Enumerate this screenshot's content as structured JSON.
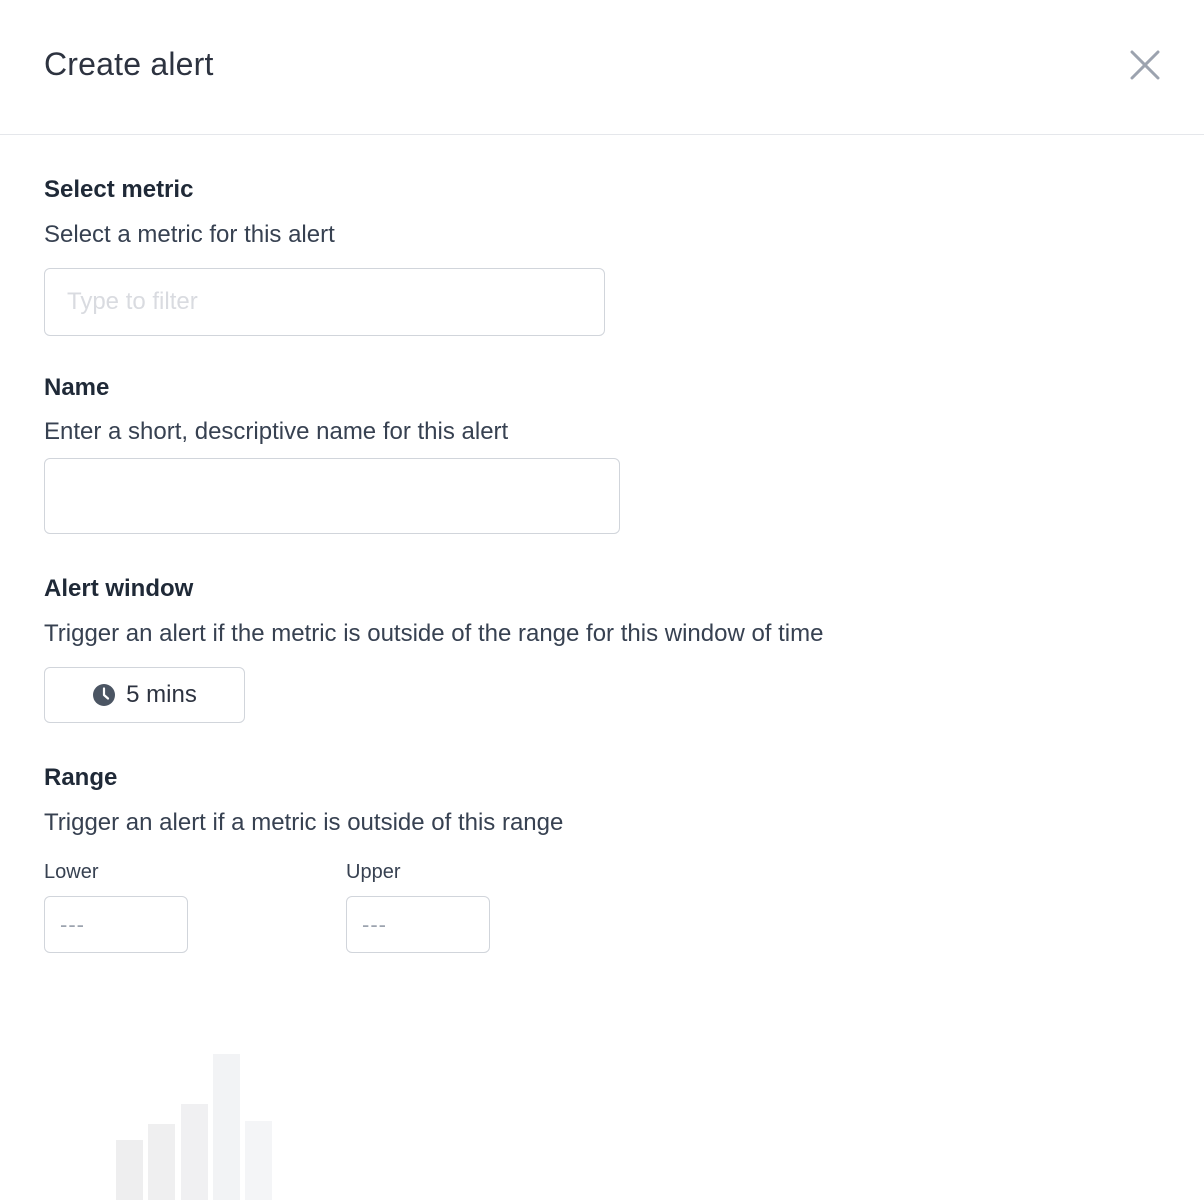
{
  "header": {
    "title": "Create alert"
  },
  "metric": {
    "label": "Select metric",
    "description": "Select a metric for this alert",
    "placeholder": "Type to filter"
  },
  "name": {
    "label": "Name",
    "description": "Enter a short, descriptive name for this alert",
    "value": ""
  },
  "window": {
    "label": "Alert window",
    "description": "Trigger an alert if the metric is outside of the range for this window of time",
    "value": "5 mins",
    "icon": "clock-icon"
  },
  "range": {
    "label": "Range",
    "description": "Trigger an alert if a metric is outside of this range",
    "lower_label": "Lower",
    "upper_label": "Upper",
    "lower_placeholder": "---",
    "upper_placeholder": "---"
  },
  "colors": {
    "text_dark": "#1f2937",
    "border": "#d1d5db",
    "placeholder": "#d9dbe0",
    "icon_gray": "#4b5563",
    "close_gray": "#9ca3af"
  }
}
